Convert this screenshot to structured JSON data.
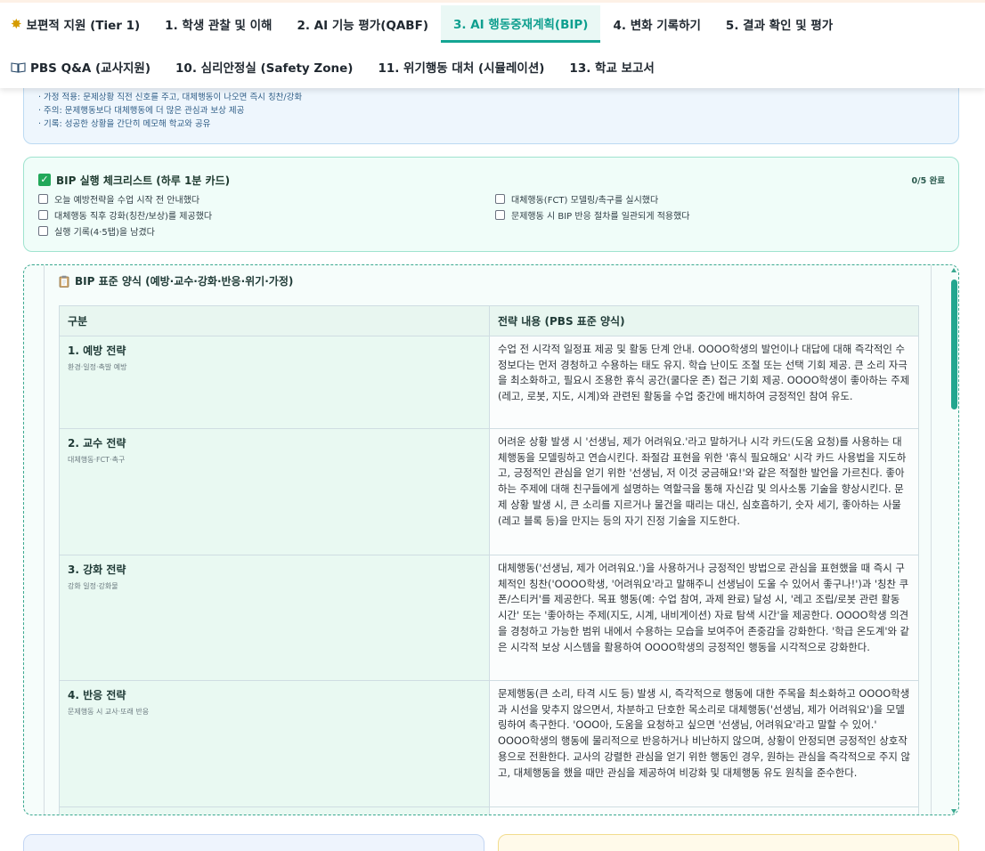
{
  "nav": {
    "row1": [
      {
        "label": "보편적 지원 (Tier 1)",
        "icon": "sparkle-icon",
        "active": false
      },
      {
        "label": "1. 학생 관찰 및 이해",
        "active": false
      },
      {
        "label": "2. AI 기능 평가(QABF)",
        "active": false
      },
      {
        "label": "3. AI 행동중재계획(BIP)",
        "active": true
      },
      {
        "label": "4. 변화 기록하기",
        "active": false
      },
      {
        "label": "5. 결과 확인 및 평가",
        "active": false
      }
    ],
    "row2": [
      {
        "label": "PBS Q&A (교사지원)",
        "icon": "book-icon",
        "active": false
      },
      {
        "label": "10. 심리안정실 (Safety Zone)",
        "active": false
      },
      {
        "label": "11. 위기행동 대처 (시뮬레이션)",
        "active": false
      },
      {
        "label": "13. 학교 보고서",
        "active": false
      }
    ]
  },
  "tips": {
    "lines": [
      "· 가정 적용: 문제상황 직전 신호를 주고, 대체행동이 나오면 즉시 칭찬/강화",
      "· 주의: 문제행동보다 대체행동에 더 많은 관심과 보상 제공",
      "· 기록: 성공한 상황을 간단히 메모해 학교와 공유"
    ]
  },
  "checklist": {
    "title": "BIP 실행 체크리스트 (하루 1분 카드)",
    "progress": "0/5 완료",
    "items": [
      {
        "label": "오늘 예방전략을 수업 시작 전 안내했다",
        "checked": false
      },
      {
        "label": "대체행동(FCT) 모델링/촉구를 실시했다",
        "checked": false
      },
      {
        "label": "대체행동 직후 강화(칭찬/보상)를 제공했다",
        "checked": false
      },
      {
        "label": "문제행동 시 BIP 반응 절차를 일관되게 적용했다",
        "checked": false
      },
      {
        "label": "실행 기록(4·5탭)을 남겼다",
        "checked": false
      }
    ]
  },
  "bip": {
    "title": "BIP 표준 양식 (예방·교수·강화·반응·위기·가정)",
    "col_category": "구분",
    "col_content": "전략 내용 (PBS 표준 양식)",
    "rows": [
      {
        "name": "1. 예방 전략",
        "sub": "환경·일정·촉발 예방",
        "text": "수업 전 시각적 일정표 제공 및 활동 단계 안내. OOOO학생의 발언이나 대답에 대해 즉각적인 수정보다는 먼저 경청하고 수용하는 태도 유지. 학습 난이도 조절 또는 선택 기회 제공. 큰 소리 자극을 최소화하고, 필요시 조용한 휴식 공간(쿨다운 존) 접근 기회 제공. OOOO학생이 좋아하는 주제(레고, 로봇, 지도, 시계)와 관련된 활동을 수업 중간에 배치하여 긍정적인 참여 유도."
      },
      {
        "name": "2. 교수 전략",
        "sub": "대체행동·FCT·촉구",
        "text": "어려운 상황 발생 시 '선생님, 제가 어려워요.'라고 말하거나 시각 카드(도움 요청)를 사용하는 대체행동을 모델링하고 연습시킨다. 좌절감 표현을 위한 '휴식 필요해요' 시각 카드 사용법을 지도하고, 긍정적인 관심을 얻기 위한 '선생님, 저 이것 궁금해요!'와 같은 적절한 발언을 가르친다. 좋아하는 주제에 대해 친구들에게 설명하는 역할극을 통해 자신감 및 의사소통 기술을 향상시킨다. 문제 상황 발생 시, 큰 소리를 지르거나 물건을 때리는 대신, 심호흡하기, 숫자 세기, 좋아하는 사물(레고 블록 등)을 만지는 등의 자기 진정 기술을 지도한다."
      },
      {
        "name": "3. 강화 전략",
        "sub": "강화 일정·강화물",
        "text": "대체행동('선생님, 제가 어려워요.')을 사용하거나 긍정적인 방법으로 관심을 표현했을 때 즉시 구체적인 칭찬('OOOO학생, '어려워요'라고 말해주니 선생님이 도울 수 있어서 좋구나!')과 '칭찬 쿠폰/스티커'를 제공한다. 목표 행동(예: 수업 참여, 과제 완료) 달성 시, '레고 조립/로봇 관련 활동 시간' 또는 '좋아하는 주제(지도, 시계, 내비게이션) 자료 탐색 시간'을 제공한다. OOOO학생 의견을 경청하고 가능한 범위 내에서 수용하는 모습을 보여주어 존중감을 강화한다. '학급 온도계'와 같은 시각적 보상 시스템을 활용하여 OOOO학생의 긍정적인 행동을 시각적으로 강화한다."
      },
      {
        "name": "4. 반응 전략",
        "sub": "문제행동 시 교사·또래 반응",
        "text": "문제행동(큰 소리, 타격 시도 등) 발생 시, 즉각적으로 행동에 대한 주목을 최소화하고 OOOO학생과 시선을 맞추지 않으면서, 차분하고 단호한 목소리로 대체행동('선생님, 제가 어려워요')을 모델링하여 촉구한다. 'OOO아, 도움을 요청하고 싶으면 '선생님, 어려워요'라고 말할 수 있어.' OOOO학생의 행동에 물리적으로 반응하거나 비난하지 않으며, 상황이 안정되면 긍정적인 상호작용으로 전환한다. 교사의 강렬한 관심을 얻기 위한 행동인 경우, 원하는 관심을 즉각적으로 주지 않고, 대체행동을 했을 때만 관심을 제공하여 비강화 및 대체행동 유도 원칙을 준수한다."
      }
    ]
  },
  "colors": {
    "accent": "#14a593",
    "checklist_bg": "#f0fdf9",
    "tip_bg": "#eef6fd"
  }
}
